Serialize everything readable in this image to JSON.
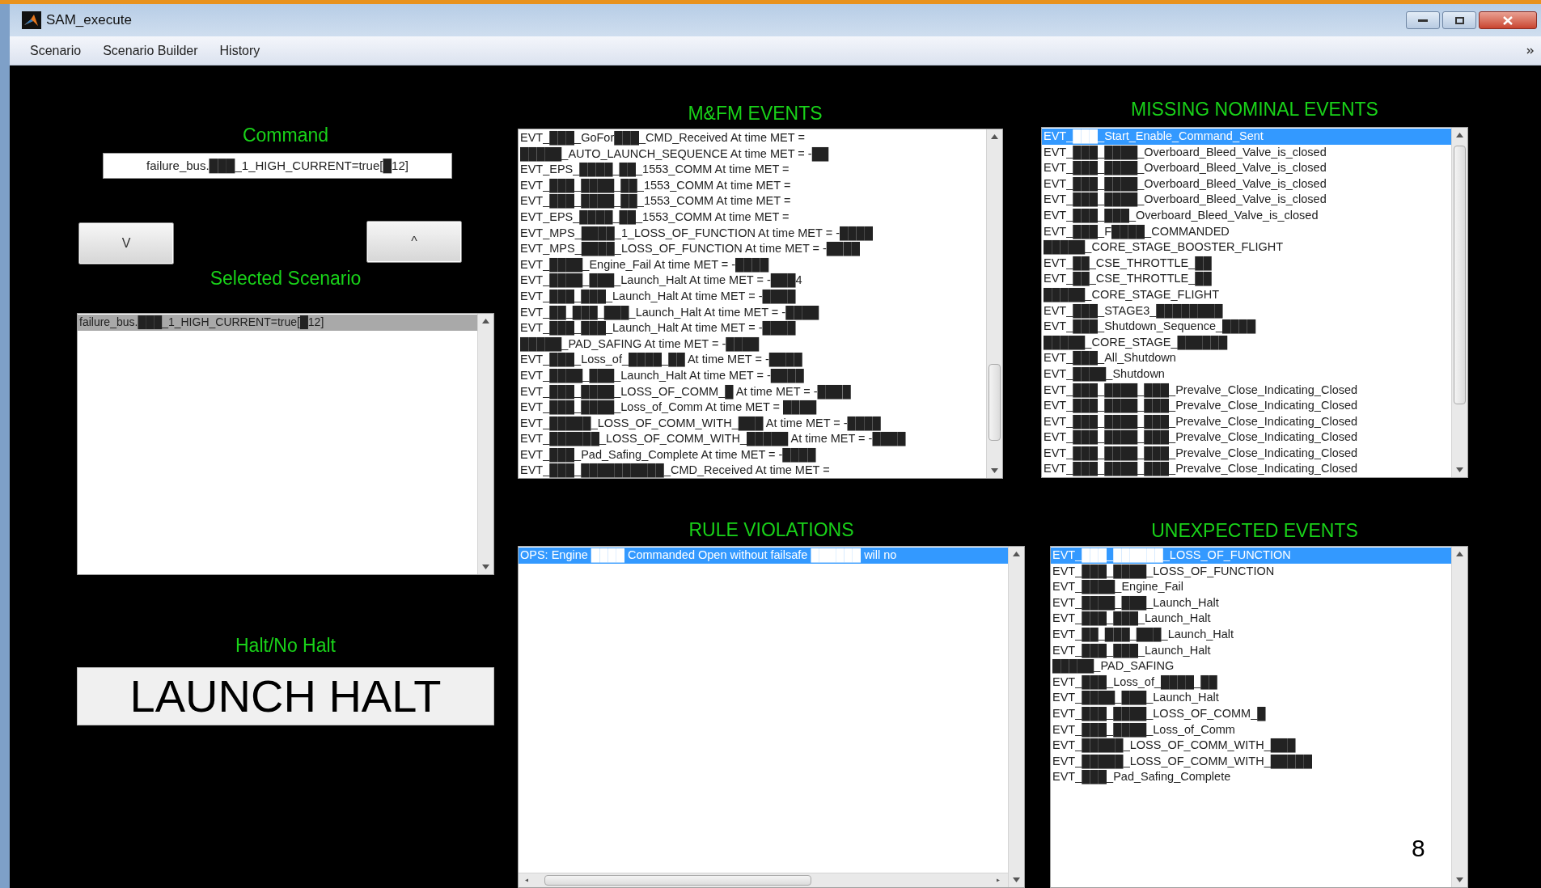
{
  "window": {
    "title": "SAM_execute"
  },
  "menu": [
    "Scenario",
    "Scenario Builder",
    "History"
  ],
  "command": {
    "label": "Command",
    "value": "failure_bus.███_1_HIGH_CURRENT=true[█12]"
  },
  "buttons": [
    "V",
    "^"
  ],
  "selected_scenario": {
    "label": "Selected Scenario",
    "items": [
      {
        "text": "failure_bus.███_1_HIGH_CURRENT=true[█12]",
        "selected": true
      }
    ]
  },
  "halt": {
    "label": "Halt/No Halt",
    "status": "LAUNCH HALT"
  },
  "mfm_events": {
    "title": "M&FM EVENTS",
    "items": [
      {
        "text": "EVT_███_GoFor███_CMD_Received At time MET =",
        "selected": false
      },
      {
        "text": "█████_AUTO_LAUNCH_SEQUENCE At time MET = -██",
        "selected": false
      },
      {
        "text": "EVT_EPS_████_██_1553_COMM At time MET =",
        "selected": false
      },
      {
        "text": "EVT_███_████_██_1553_COMM At time MET =",
        "selected": false
      },
      {
        "text": "EVT_███_████_██_1553_COMM At time MET =",
        "selected": false
      },
      {
        "text": "EVT_EPS_████_██_1553_COMM At time MET =",
        "selected": false
      },
      {
        "text": "EVT_MPS_████_1_LOSS_OF_FUNCTION At time MET = -████",
        "selected": false
      },
      {
        "text": "EVT_MPS_████_LOSS_OF_FUNCTION At time MET = -████",
        "selected": false
      },
      {
        "text": "EVT_████_Engine_Fail At time MET = -████",
        "selected": false
      },
      {
        "text": "EVT_████_███_Launch_Halt At time MET = -███4",
        "selected": false
      },
      {
        "text": "EVT_███_███_Launch_Halt At time MET = -████",
        "selected": false
      },
      {
        "text": "EVT_██_███_███_Launch_Halt At time MET = -████",
        "selected": false
      },
      {
        "text": "EVT_███_███_Launch_Halt At time MET = -████",
        "selected": false
      },
      {
        "text": "█████_PAD_SAFING At time MET = -████",
        "selected": false
      },
      {
        "text": "EVT_███_Loss_of_████_██ At time MET = -████",
        "selected": false
      },
      {
        "text": "EVT_████_███_Launch_Halt At time MET = -████",
        "selected": false
      },
      {
        "text": "EVT_███_████_LOSS_OF_COMM_█ At time MET = -████",
        "selected": false
      },
      {
        "text": "EVT_███_████_Loss_of_Comm At time MET = ████",
        "selected": false
      },
      {
        "text": "EVT_█████_LOSS_OF_COMM_WITH_███ At time MET = -████",
        "selected": false
      },
      {
        "text": "EVT_██████_LOSS_OF_COMM_WITH_█████ At time MET = -████",
        "selected": false
      },
      {
        "text": "EVT_███_Pad_Safing_Complete At time MET = -████",
        "selected": false
      },
      {
        "text": "EVT_███_██████████_CMD_Received At time MET =",
        "selected": false
      }
    ]
  },
  "missing_nominal_events": {
    "title": "MISSING NOMINAL EVENTS",
    "items": [
      {
        "text": "EVT_███_Start_Enable_Command_Sent",
        "selected": true
      },
      {
        "text": "EVT_███_████_Overboard_Bleed_Valve_is_closed",
        "selected": false
      },
      {
        "text": "EVT_███_████_Overboard_Bleed_Valve_is_closed",
        "selected": false
      },
      {
        "text": "EVT_███_████_Overboard_Bleed_Valve_is_closed",
        "selected": false
      },
      {
        "text": "EVT_███_████_Overboard_Bleed_Valve_is_closed",
        "selected": false
      },
      {
        "text": "EVT_███_███_Overboard_Bleed_Valve_is_closed",
        "selected": false
      },
      {
        "text": "EVT_███_F████_COMMANDED",
        "selected": false
      },
      {
        "text": "█████_CORE_STAGE_BOOSTER_FLIGHT",
        "selected": false
      },
      {
        "text": "EVT_██_CSE_THROTTLE_██",
        "selected": false
      },
      {
        "text": "EVT_██_CSE_THROTTLE_██",
        "selected": false
      },
      {
        "text": "█████_CORE_STAGE_FLIGHT",
        "selected": false
      },
      {
        "text": "EVT_███_STAGE3_████████",
        "selected": false
      },
      {
        "text": "EVT_███_Shutdown_Sequence_████",
        "selected": false
      },
      {
        "text": "█████_CORE_STAGE_██████",
        "selected": false
      },
      {
        "text": "EVT_███_All_Shutdown",
        "selected": false
      },
      {
        "text": "EVT_████_Shutdown",
        "selected": false
      },
      {
        "text": "EVT_███_████_███_Prevalve_Close_Indicating_Closed",
        "selected": false
      },
      {
        "text": "EVT_███_████_███_Prevalve_Close_Indicating_Closed",
        "selected": false
      },
      {
        "text": "EVT_███_████_███_Prevalve_Close_Indicating_Closed",
        "selected": false
      },
      {
        "text": "EVT_███_████_███_Prevalve_Close_Indicating_Closed",
        "selected": false
      },
      {
        "text": "EVT_███_████_███_Prevalve_Close_Indicating_Closed",
        "selected": false
      },
      {
        "text": "EVT_███_████_███_Prevalve_Close_Indicating_Closed",
        "selected": false
      }
    ]
  },
  "rule_violations": {
    "title": "RULE VIOLATIONS",
    "items": [
      {
        "text": "OPS: Engine ████ Commanded Open without failsafe ██████ will no",
        "selected": true
      }
    ]
  },
  "unexpected_events": {
    "title": "UNEXPECTED EVENTS",
    "items": [
      {
        "text": "EVT_███_██████_LOSS_OF_FUNCTION",
        "selected": true
      },
      {
        "text": "EVT_███_████_LOSS_OF_FUNCTION",
        "selected": false
      },
      {
        "text": "EVT_████_Engine_Fail",
        "selected": false
      },
      {
        "text": "EVT_████_███_Launch_Halt",
        "selected": false
      },
      {
        "text": "EVT_███_███_Launch_Halt",
        "selected": false
      },
      {
        "text": "EVT_██_███_███_Launch_Halt",
        "selected": false
      },
      {
        "text": "EVT_███_███_Launch_Halt",
        "selected": false
      },
      {
        "text": "█████_PAD_SAFING",
        "selected": false
      },
      {
        "text": "EVT_███_Loss_of_████_██",
        "selected": false
      },
      {
        "text": "EVT_████_███_Launch_Halt",
        "selected": false
      },
      {
        "text": "EVT_███_████_LOSS_OF_COMM_█",
        "selected": false
      },
      {
        "text": "EVT_███_████_Loss_of_Comm",
        "selected": false
      },
      {
        "text": "EVT_█████_LOSS_OF_COMM_WITH_███",
        "selected": false
      },
      {
        "text": "EVT_█████_LOSS_OF_COMM_WITH_█████",
        "selected": false
      },
      {
        "text": "EVT_███_Pad_Safing_Complete",
        "selected": false
      }
    ]
  },
  "page_number": "8"
}
